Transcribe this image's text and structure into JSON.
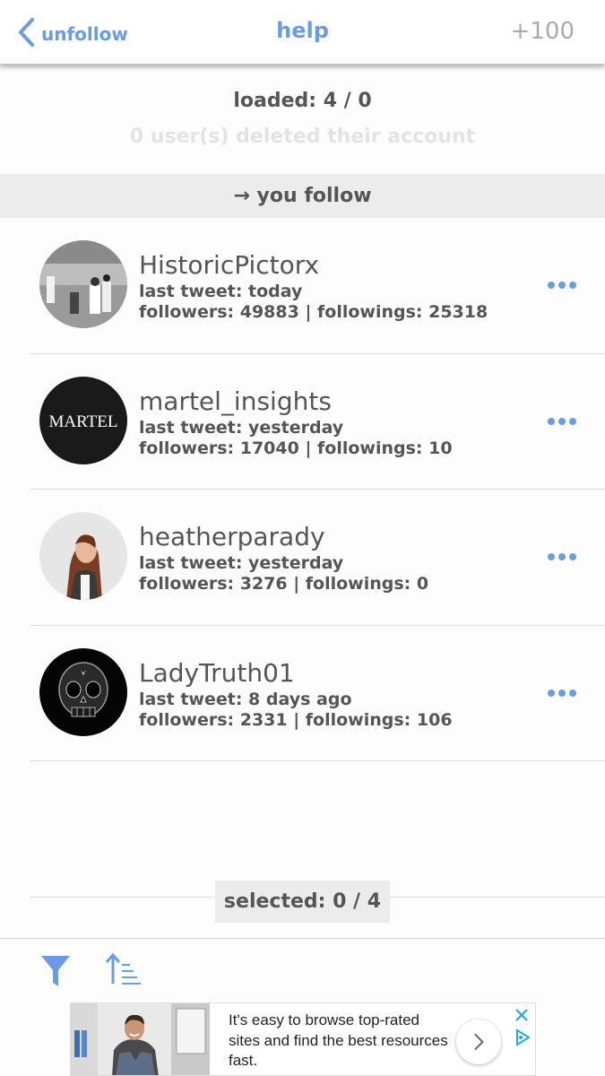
{
  "nav": {
    "back_label": "unfollow",
    "title": "help",
    "right_label": "+100"
  },
  "status": {
    "loaded": "loaded: 4 / 0",
    "deleted": "0 user(s) deleted their account"
  },
  "section": {
    "label": "→ you follow"
  },
  "users": [
    {
      "name": "HistoricPictorx",
      "last_tweet": "last tweet: today",
      "stats": "followers: 49883 | followings: 25318",
      "avatar": "historic-photo"
    },
    {
      "name": "martel_insights",
      "last_tweet": "last tweet: yesterday",
      "stats": "followers: 17040 | followings: 10",
      "avatar": "martel-logo",
      "avatar_text": "MARTEL"
    },
    {
      "name": "heatherparady",
      "last_tweet": "last tweet: yesterday",
      "stats": "followers: 3276 | followings: 0",
      "avatar": "woman-portrait"
    },
    {
      "name": "LadyTruth01",
      "last_tweet": "last tweet: 8 days ago",
      "stats": "followers: 2331 | followings: 106",
      "avatar": "skull-image"
    }
  ],
  "selection": {
    "label": "selected: 0 / 4"
  },
  "toolbar": {
    "filter_icon": "filter-icon",
    "sort_icon": "sort-icon"
  },
  "ad": {
    "text": "It's easy to browse top-rated sites and find the best resources fast.",
    "arrow_icon": "chevron-right-icon",
    "close_icon": "close-icon"
  },
  "colors": {
    "accent": "#6b9be0",
    "text": "#555555",
    "muted": "#e3e3e3",
    "header_bg": "#ececec"
  }
}
